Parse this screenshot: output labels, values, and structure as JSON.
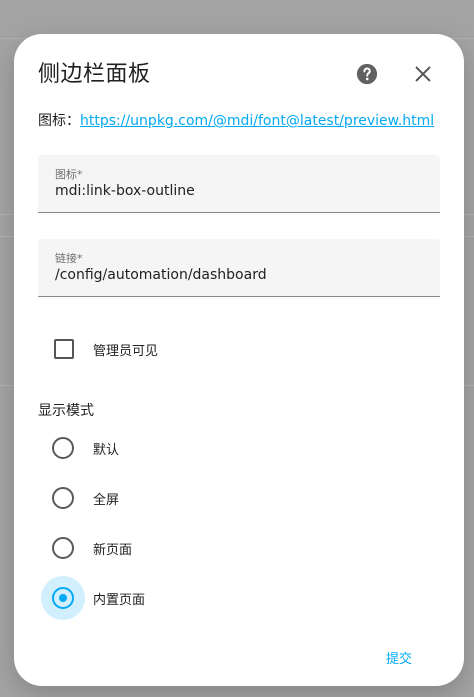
{
  "dialog": {
    "title": "侧边栏面板",
    "help_icon": "help-circle-icon",
    "close_icon": "close-icon"
  },
  "icon_ref": {
    "label": "图标：",
    "link": "https://unpkg.com/@mdi/font@latest/preview.html"
  },
  "fields": {
    "icon": {
      "label": "图标*",
      "value": "mdi:link-box-outline"
    },
    "url": {
      "label": "链接*",
      "value": "/config/automation/dashboard"
    }
  },
  "admin_checkbox": {
    "label": "管理员可见",
    "checked": false
  },
  "display_mode": {
    "title": "显示模式",
    "options": [
      {
        "label": "默认",
        "checked": false
      },
      {
        "label": "全屏",
        "checked": false
      },
      {
        "label": "新页面",
        "checked": false
      },
      {
        "label": "内置页面",
        "checked": true
      }
    ]
  },
  "actions": {
    "submit": "提交"
  },
  "colors": {
    "accent": "#03a9f4"
  }
}
